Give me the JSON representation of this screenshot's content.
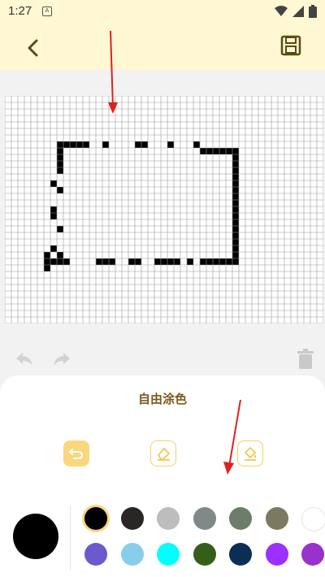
{
  "status": {
    "time": "1:27",
    "notification_icon": "A"
  },
  "appbar": {
    "back_icon": "chevron-left-icon",
    "save_icon": "floppy-disk-icon"
  },
  "panel": {
    "title": "自由涂色"
  },
  "tools": [
    "undo-stroke-tool",
    "eraser-tool",
    "fill-bucket-tool"
  ],
  "current_color": "#000000",
  "palette_row1": [
    "#000000",
    "#2b2626",
    "#bdbdbd",
    "#7f8a88",
    "#6c7e6a",
    "#7a7a60",
    "#ffffff"
  ],
  "palette_row2": [
    "#6a5acd",
    "#87ceeb",
    "#00ffff",
    "#355e1b",
    "#0b2e55",
    "#9b30ff",
    "#9932cc"
  ]
}
